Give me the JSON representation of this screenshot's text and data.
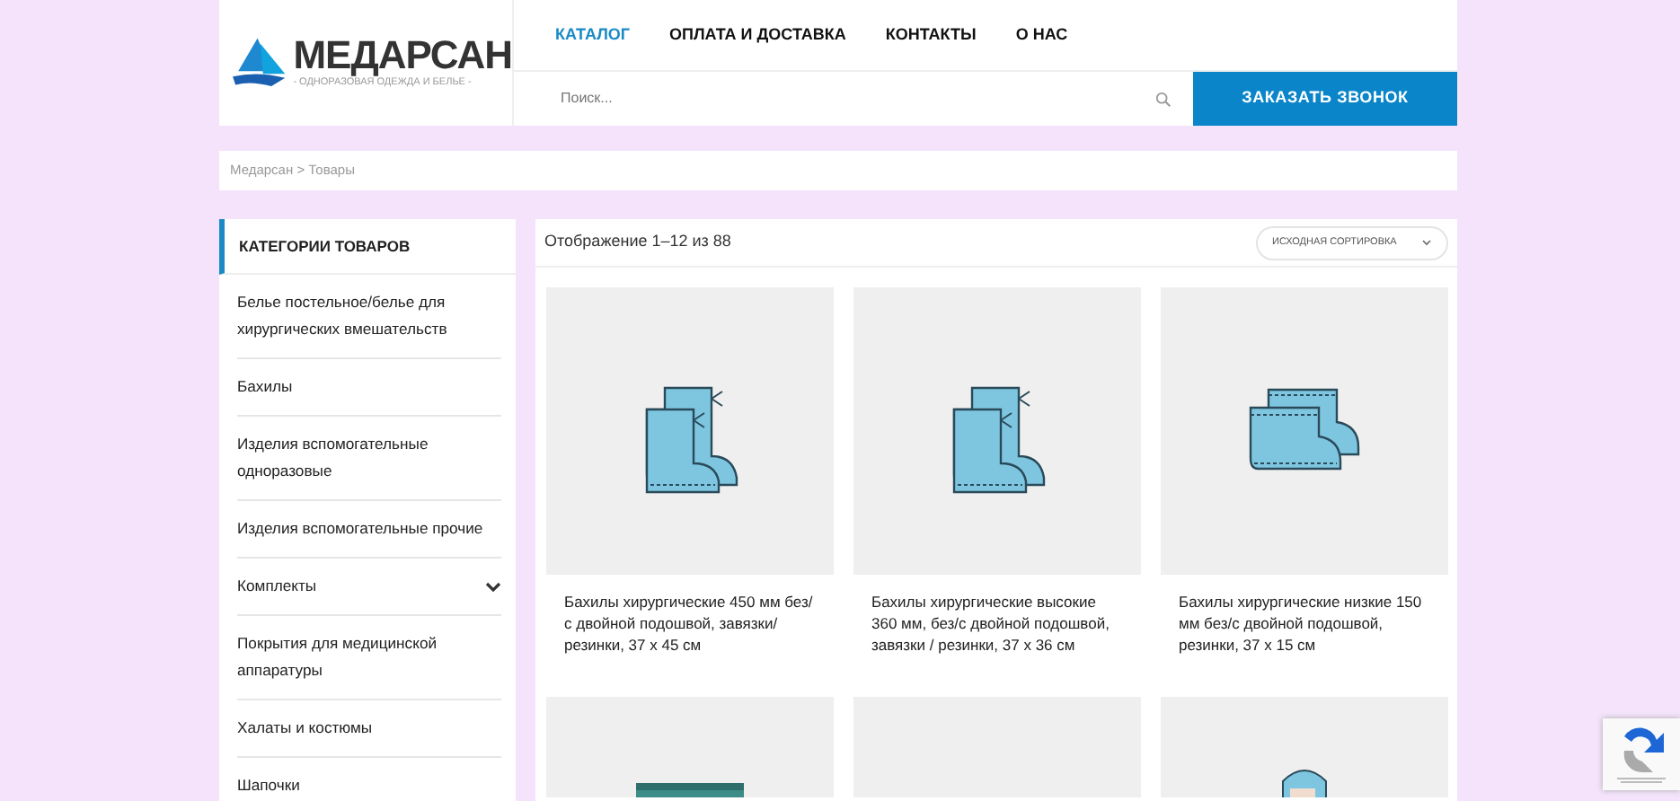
{
  "logo": {
    "name": "МЕДАРСАН",
    "tagline": "- ОДНОРАЗОВАЯ ОДЕЖДА И БЕЛЬЕ -"
  },
  "nav": [
    {
      "label": "КАТАЛОГ",
      "selected": true
    },
    {
      "label": "ОПЛАТА И ДОСТАВКА",
      "selected": false
    },
    {
      "label": "КОНТАКТЫ",
      "selected": false
    },
    {
      "label": "О НАС",
      "selected": false
    }
  ],
  "search": {
    "placeholder": "Поиск..."
  },
  "call_button": "ЗАКАЗАТЬ ЗВОНОК",
  "breadcrumb": "Медарсан > Товары",
  "sidebar": {
    "title": "КАТЕГОРИИ ТОВАРОВ",
    "items": [
      {
        "label": "Белье постельное/белье для хирургических вмешательств",
        "has_children": false
      },
      {
        "label": "Бахилы",
        "has_children": false
      },
      {
        "label": "Изделия вспомогательные одноразовые",
        "has_children": false
      },
      {
        "label": "Изделия вспомогательные прочие",
        "has_children": false
      },
      {
        "label": "Комплекты",
        "has_children": true
      },
      {
        "label": "Покрытия для медицинской аппаратуры",
        "has_children": false
      },
      {
        "label": "Халаты и костюмы",
        "has_children": false
      },
      {
        "label": "Шапочки",
        "has_children": false
      }
    ]
  },
  "result_count": "Отображение 1–12 из 88",
  "sort": {
    "value": "ИСХОДНАЯ СОРТИРОВКА"
  },
  "products": [
    {
      "kind": "bootie-high",
      "title": "Бахилы хирургические 450 мм без/с двойной подошвой, завязки/резинки, 37 х 45 см"
    },
    {
      "kind": "bootie-high",
      "title": "Бахилы хирургические высокие 360 мм, без/с двойной подошвой, завязки / резинки, 37 х 36 см"
    },
    {
      "kind": "bootie-low",
      "title": "Бахилы хирургические низкие 150 мм без/с двойной подошвой, резинки, 37 х 15 см"
    },
    {
      "kind": "folded"
    },
    {
      "kind": "blank"
    },
    {
      "kind": "suit"
    }
  ]
}
